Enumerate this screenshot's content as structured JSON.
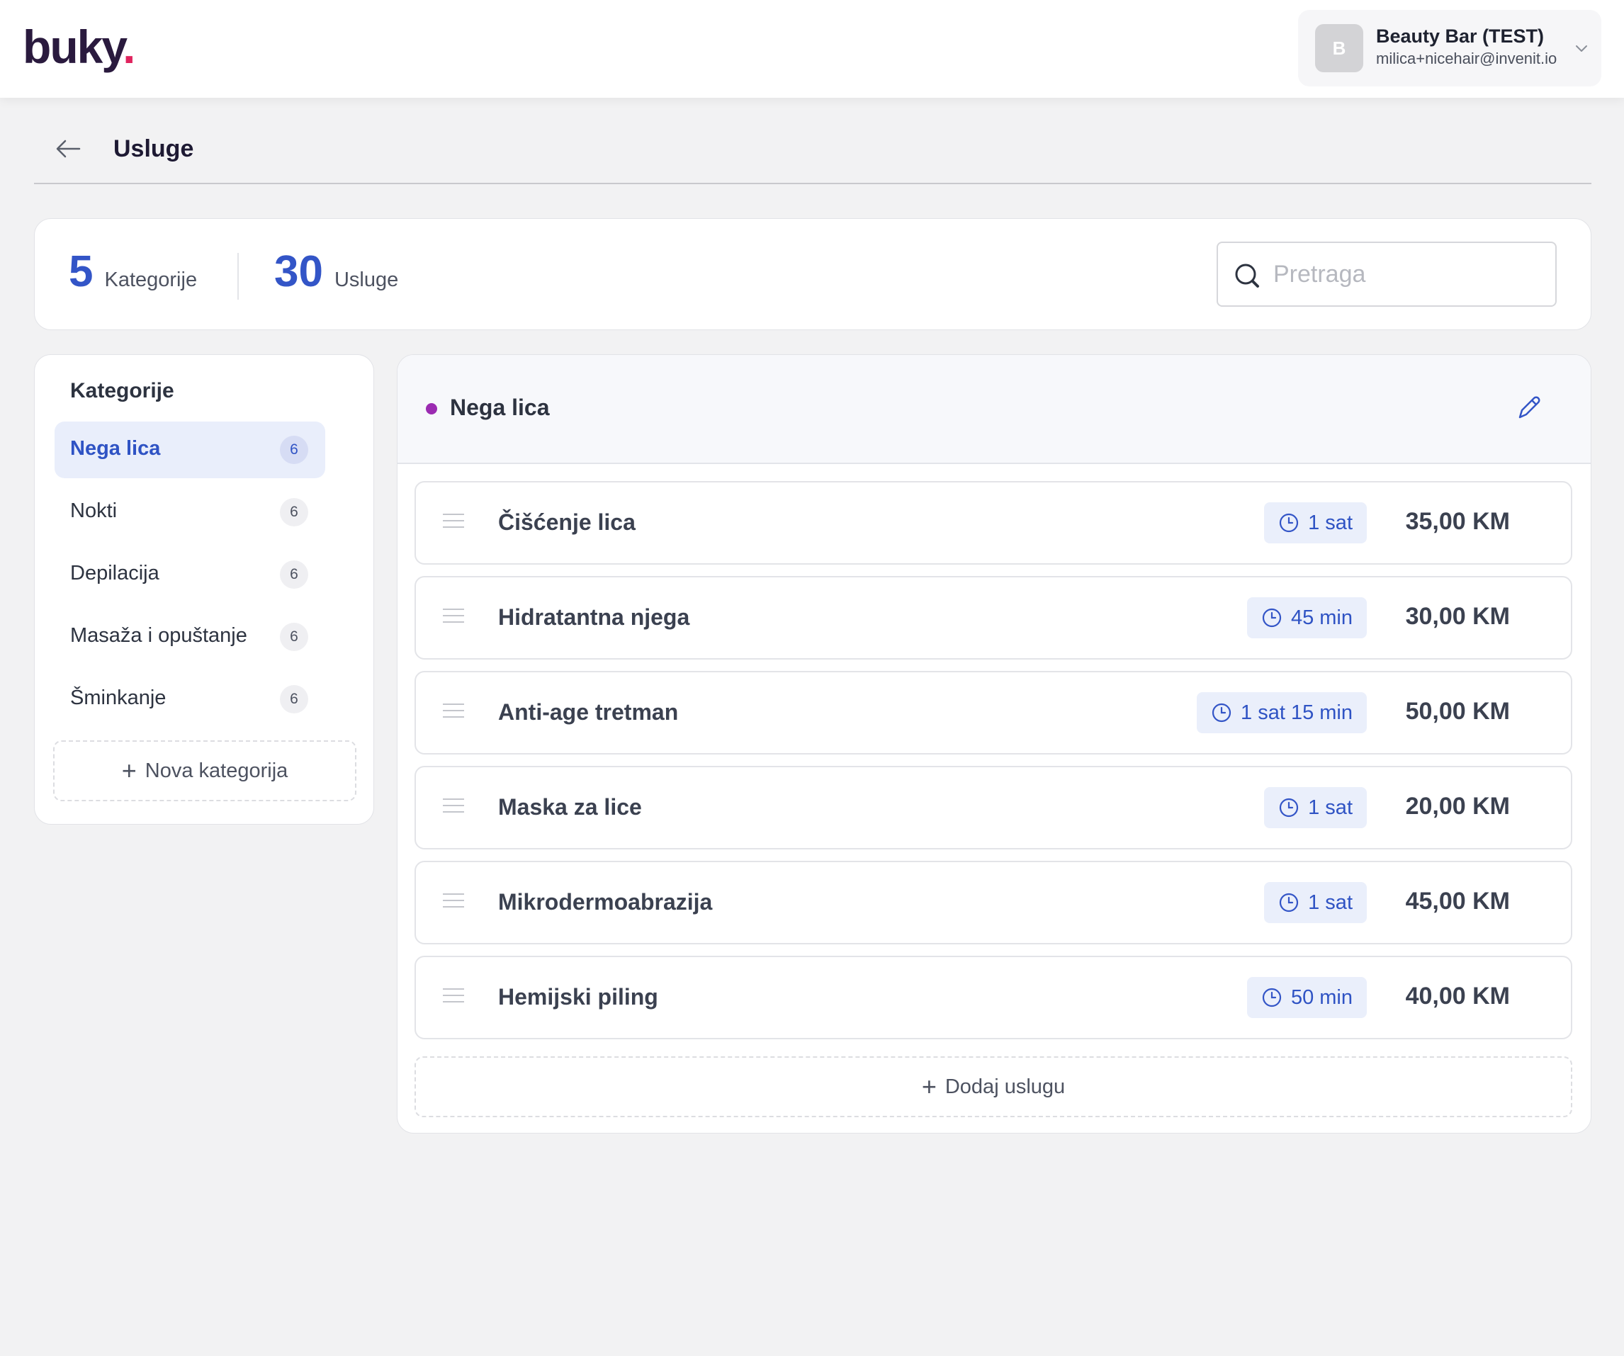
{
  "brand": {
    "logo_text": "buky",
    "logo_dot": ".",
    "dot_color": "#e0245e"
  },
  "account": {
    "avatar_initial": "B",
    "name": "Beauty Bar (TEST)",
    "email": "milica+nicehair@invenit.io",
    "icon": "chevron-down-icon"
  },
  "page": {
    "title": "Usluge",
    "back_icon": "arrow-left-icon"
  },
  "stats": {
    "categories_count": "5",
    "categories_label": "Kategorije",
    "services_count": "30",
    "services_label": "Usluge"
  },
  "search": {
    "placeholder": "Pretraga",
    "value": "",
    "icon": "search-icon"
  },
  "categories": {
    "title": "Kategorije",
    "items": [
      {
        "label": "Nega lica",
        "count": "6",
        "active": true
      },
      {
        "label": "Nokti",
        "count": "6",
        "active": false
      },
      {
        "label": "Depilacija",
        "count": "6",
        "active": false
      },
      {
        "label": "Masaža i opuštanje",
        "count": "6",
        "active": false
      },
      {
        "label": "Šminkanje",
        "count": "6",
        "active": false
      }
    ],
    "new_label": "Nova kategorija"
  },
  "selected_category": {
    "name": "Nega lica",
    "dot_color": "#9b2bb1",
    "edit_icon": "pencil-icon"
  },
  "services": [
    {
      "name": "Čišćenje lica",
      "duration": "1 sat",
      "price": "35,00 KM"
    },
    {
      "name": "Hidratantna njega",
      "duration": "45 min",
      "price": "30,00 KM"
    },
    {
      "name": "Anti-age tretman",
      "duration": "1 sat 15 min",
      "price": "50,00 KM"
    },
    {
      "name": "Maska za lice",
      "duration": "1 sat",
      "price": "20,00 KM"
    },
    {
      "name": "Mikrodermoabrazija",
      "duration": "1 sat",
      "price": "45,00 KM"
    },
    {
      "name": "Hemijski piling",
      "duration": "50 min",
      "price": "40,00 KM"
    }
  ],
  "add_service_label": "Dodaj uslugu",
  "colors": {
    "accent": "#3355c7",
    "background": "#f2f2f3"
  }
}
